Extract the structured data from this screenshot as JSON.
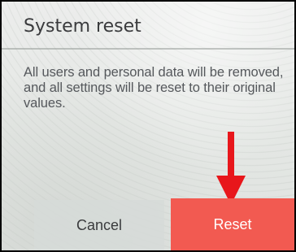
{
  "dialog": {
    "title": "System reset",
    "message": "All users and personal data will be removed, and all settings will be reset to their original values.",
    "cancel_label": "Cancel",
    "reset_label": "Reset"
  },
  "annotation": {
    "arrow_icon": "arrow-down-icon",
    "arrow_color": "#e8161b"
  },
  "colors": {
    "reset_button": "#f25a51",
    "cancel_button": "#d6dad8",
    "title_text": "#3a3b3d",
    "message_text": "#55585c"
  }
}
